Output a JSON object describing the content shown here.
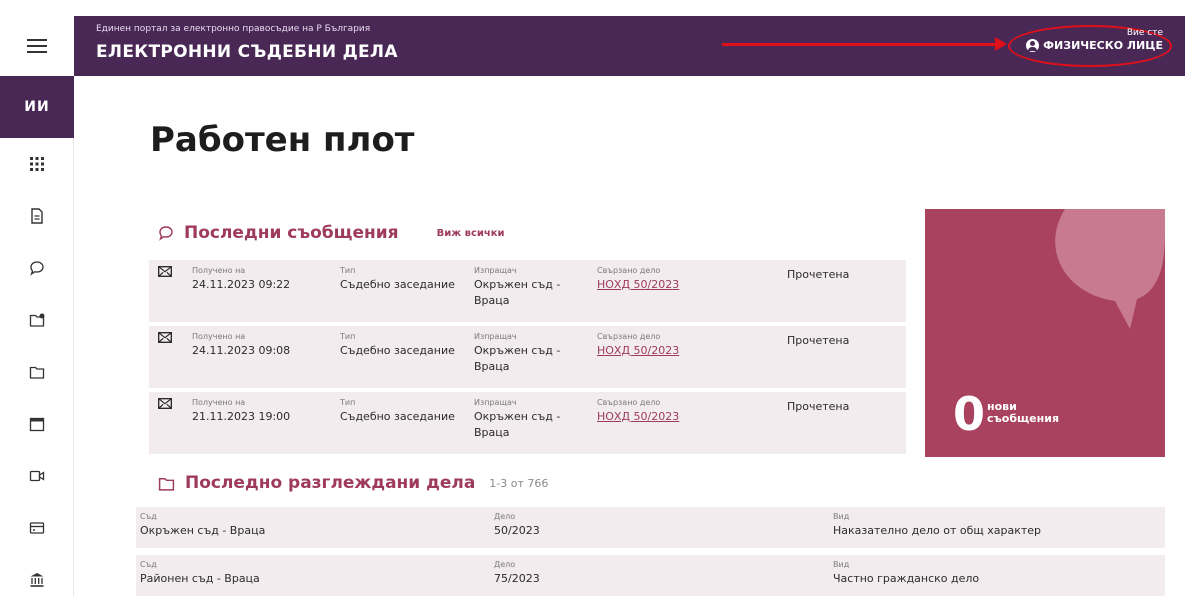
{
  "header": {
    "portal_subtitle": "Единен портал за електронно правосъдие на Р България",
    "portal_title": "ЕЛЕКТРОННИ СЪДЕБНИ ДЕЛА",
    "user_prefix": "Вие сте",
    "user_role": "ФИЗИЧЕСКО ЛИЦЕ"
  },
  "sidebar": {
    "initials": "ИИ",
    "items": [
      {
        "icon": "grid-icon"
      },
      {
        "icon": "document-icon"
      },
      {
        "icon": "chat-icon"
      },
      {
        "icon": "folder-alert-icon"
      },
      {
        "icon": "folder-icon"
      },
      {
        "icon": "calendar-icon"
      },
      {
        "icon": "video-icon"
      },
      {
        "icon": "card-icon"
      },
      {
        "icon": "court-icon"
      }
    ]
  },
  "main": {
    "title": "Работен плот",
    "messages": {
      "title": "Последни съобщения",
      "see_all": "Виж всички",
      "labels": {
        "received": "Получено на",
        "type": "Тип",
        "sender": "Изпращач",
        "case": "Свързано дело"
      },
      "rows": [
        {
          "received": "24.11.2023 09:22",
          "type": "Съдебно заседание",
          "sender": "Окръжен съд - Враца",
          "case": "НОХД 50/2023",
          "status": "Прочетена"
        },
        {
          "received": "24.11.2023 09:08",
          "type": "Съдебно заседание",
          "sender": "Окръжен съд - Враца",
          "case": "НОХД 50/2023",
          "status": "Прочетена"
        },
        {
          "received": "21.11.2023 19:00",
          "type": "Съдебно заседание",
          "sender": "Окръжен съд - Враца",
          "case": "НОХД 50/2023",
          "status": "Прочетена"
        }
      ],
      "new_count": "0",
      "new_label_1": "нови",
      "new_label_2": "съобщения"
    },
    "cases": {
      "title": "Последно разглеждани дела",
      "count": "1-3 от 766",
      "labels": {
        "court": "Съд",
        "case": "Дело",
        "kind": "Вид"
      },
      "rows": [
        {
          "court": "Окръжен съд - Враца",
          "case": "50/2023",
          "kind": "Наказателно дело от общ характер"
        },
        {
          "court": "Районен съд - Враца",
          "case": "75/2023",
          "kind": "Частно гражданско дело"
        }
      ]
    }
  },
  "colors": {
    "header": "#4a2856",
    "accent": "#9e3a5c",
    "tile": "#a8425f",
    "row_bg": "#f3ecee",
    "annotation": "#e0101a"
  }
}
